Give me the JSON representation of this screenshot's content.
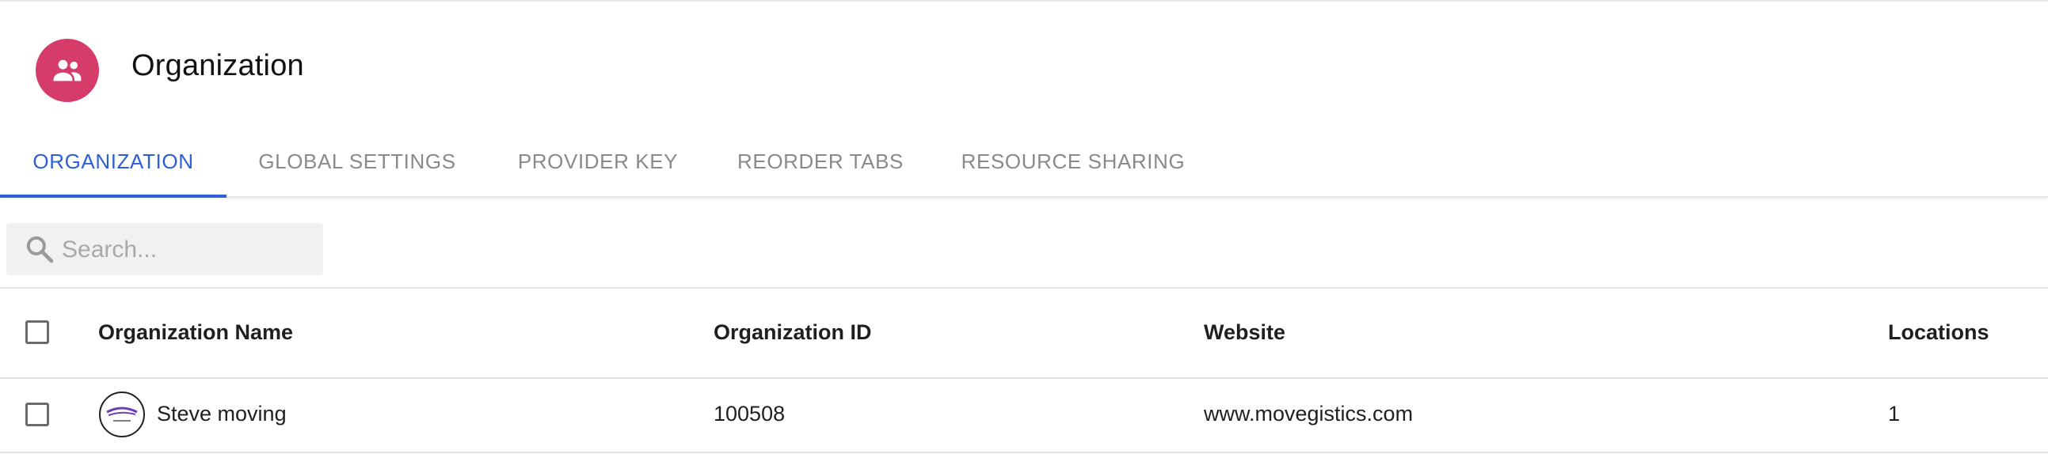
{
  "header": {
    "title": "Organization",
    "icon": "people-group-icon",
    "icon_bg_color": "#d63c6a"
  },
  "tabs": [
    {
      "label": "ORGANIZATION",
      "active": true
    },
    {
      "label": "GLOBAL SETTINGS",
      "active": false
    },
    {
      "label": "PROVIDER KEY",
      "active": false
    },
    {
      "label": "REORDER TABS",
      "active": false
    },
    {
      "label": "RESOURCE SHARING",
      "active": false
    }
  ],
  "accent_color": "#2f5fd6",
  "search": {
    "placeholder": "Search...",
    "value": ""
  },
  "table": {
    "columns": [
      "Organization Name",
      "Organization ID",
      "Website",
      "Locations"
    ],
    "rows": [
      {
        "name": "Steve moving",
        "id": "100508",
        "website": "www.movegistics.com",
        "locations": "1",
        "logo": "company-logo-icon"
      }
    ]
  }
}
